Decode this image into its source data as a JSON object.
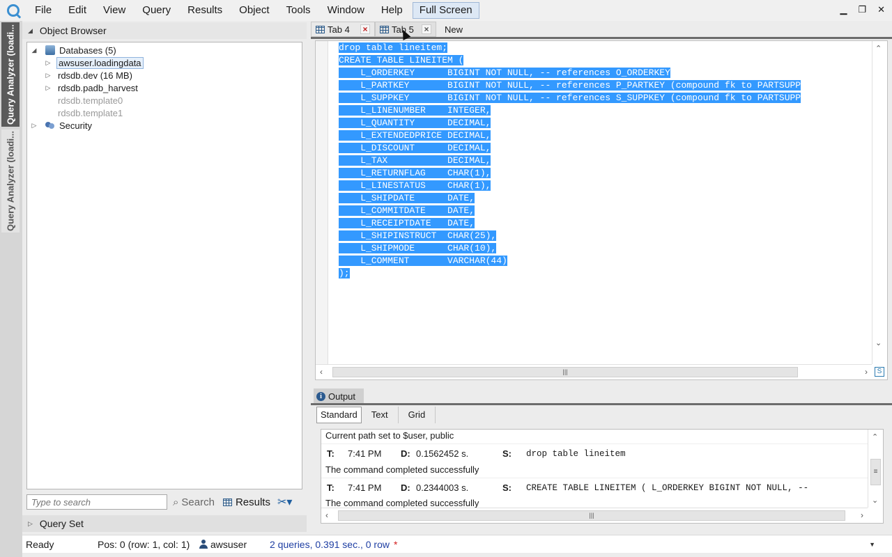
{
  "menu": [
    "File",
    "Edit",
    "View",
    "Query",
    "Results",
    "Object",
    "Tools",
    "Window",
    "Help"
  ],
  "fullscreen_label": "Full Screen",
  "side_tabs": [
    "Query Analyzer (loadi...",
    "Query Analyzer (loadi..."
  ],
  "object_browser": {
    "title": "Object Browser",
    "root": "Databases (5)",
    "items": [
      {
        "label": "awsuser.loadingdata",
        "selected": true,
        "dim": false,
        "expandable": true
      },
      {
        "label": "rdsdb.dev (16 MB)",
        "selected": false,
        "dim": false,
        "expandable": true
      },
      {
        "label": "rdsdb.padb_harvest",
        "selected": false,
        "dim": false,
        "expandable": true
      },
      {
        "label": "rdsdb.template0",
        "selected": false,
        "dim": true,
        "expandable": false
      },
      {
        "label": "rdsdb.template1",
        "selected": false,
        "dim": true,
        "expandable": false
      }
    ],
    "security": "Security",
    "search_placeholder": "Type to search",
    "search_label": "Search",
    "results_label": "Results"
  },
  "query_set": "Query Set",
  "tabs": [
    "Tab 4",
    "Tab 5"
  ],
  "new_tab": "New",
  "code": [
    "drop table lineitem;",
    "CREATE TABLE LINEITEM (",
    "    L_ORDERKEY      BIGINT NOT NULL, -- references O_ORDERKEY",
    "    L_PARTKEY       BIGINT NOT NULL, -- references P_PARTKEY (compound fk to PARTSUPP",
    "    L_SUPPKEY       BIGINT NOT NULL, -- references S_SUPPKEY (compound fk to PARTSUPP",
    "    L_LINENUMBER    INTEGER,",
    "    L_QUANTITY      DECIMAL,",
    "    L_EXTENDEDPRICE DECIMAL,",
    "    L_DISCOUNT      DECIMAL,",
    "    L_TAX           DECIMAL,",
    "    L_RETURNFLAG    CHAR(1),",
    "    L_LINESTATUS    CHAR(1),",
    "    L_SHIPDATE      DATE,",
    "    L_COMMITDATE    DATE,",
    "    L_RECEIPTDATE   DATE,",
    "    L_SHIPINSTRUCT  CHAR(25),",
    "    L_SHIPMODE      CHAR(10),",
    "    L_COMMENT       VARCHAR(44)",
    ");"
  ],
  "output": {
    "title": "Output",
    "tabs": [
      "Standard",
      "Text",
      "Grid"
    ],
    "line0": "Current path set to $user, public",
    "entries": [
      {
        "t_label": "T:",
        "time": "7:41 PM",
        "d_label": "D:",
        "duration": "0.1562452 s.",
        "s_label": "S:",
        "sql": "drop table lineitem",
        "msg": "The command completed successfully"
      },
      {
        "t_label": "T:",
        "time": "7:41 PM",
        "d_label": "D:",
        "duration": "0.2344003 s.",
        "s_label": "S:",
        "sql": "CREATE TABLE LINEITEM (  L_ORDERKEY  BIGINT NOT NULL, --",
        "msg": "The command completed successfully"
      }
    ]
  },
  "status": {
    "ready": "Ready",
    "pos": "Pos: 0 (row: 1, col: 1)",
    "user": "awsuser",
    "queries": "2 queries, 0.391 sec., 0 row",
    "star": "*"
  },
  "colors": {
    "selection": "#3399ff",
    "accent": "#1f3fa3"
  }
}
